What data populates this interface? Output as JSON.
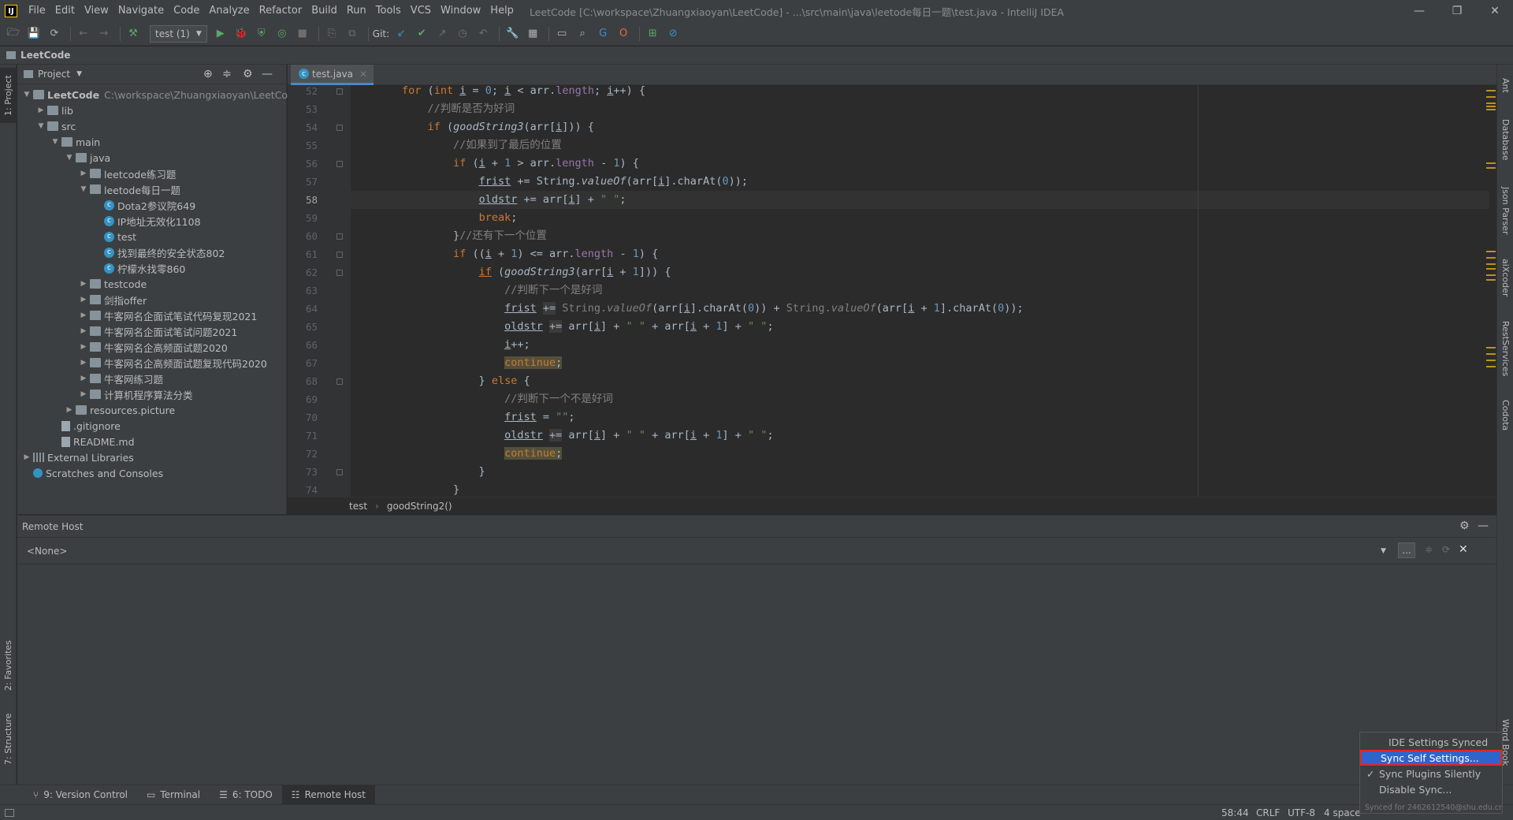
{
  "window": {
    "title": "LeetCode [C:\\workspace\\Zhuangxiaoyan\\LeetCode] - ...\\src\\main\\java\\leetode每日一题\\test.java - IntelliJ IDEA",
    "app_logo": "IJ",
    "controls": {
      "minimize": "—",
      "restore": "❐",
      "close": "✕"
    }
  },
  "menu": [
    "File",
    "Edit",
    "View",
    "Navigate",
    "Code",
    "Analyze",
    "Refactor",
    "Build",
    "Run",
    "Tools",
    "VCS",
    "Window",
    "Help"
  ],
  "toolbar": {
    "run_config": "test (1)",
    "git_label": "Git:"
  },
  "navbar": {
    "project_name": "LeetCode"
  },
  "left_strip": {
    "project_tab": "1: Project",
    "favorites_tab": "2: Favorites",
    "structure_tab": "7: Structure"
  },
  "right_strip": {
    "ant": "Ant",
    "database": "Database",
    "json_parser": "Json Parser",
    "aixcoder": "aiXcoder",
    "rest_services": "RestServices",
    "codota": "Codota",
    "word_book": "Word Book"
  },
  "project": {
    "header_label": "Project",
    "tree": [
      {
        "label": "LeetCode",
        "extra": "C:\\workspace\\Zhuangxiaoyan\\LeetCode",
        "depth": 0,
        "kind": "folder",
        "state": "open",
        "bold": true
      },
      {
        "label": "lib",
        "depth": 1,
        "kind": "folder",
        "state": "closed"
      },
      {
        "label": "src",
        "depth": 1,
        "kind": "folder",
        "state": "open"
      },
      {
        "label": "main",
        "depth": 2,
        "kind": "folder",
        "state": "open"
      },
      {
        "label": "java",
        "depth": 3,
        "kind": "folder",
        "state": "open"
      },
      {
        "label": "leetcode练习题",
        "depth": 4,
        "kind": "folder",
        "state": "closed"
      },
      {
        "label": "leetode每日一题",
        "depth": 4,
        "kind": "folder",
        "state": "open"
      },
      {
        "label": "Dota2参议院649",
        "depth": 5,
        "kind": "class",
        "state": "none"
      },
      {
        "label": "IP地址无效化1108",
        "depth": 5,
        "kind": "class",
        "state": "none"
      },
      {
        "label": "test",
        "depth": 5,
        "kind": "class",
        "state": "none"
      },
      {
        "label": "找到最终的安全状态802",
        "depth": 5,
        "kind": "class",
        "state": "none"
      },
      {
        "label": "柠檬水找零860",
        "depth": 5,
        "kind": "class",
        "state": "none"
      },
      {
        "label": "testcode",
        "depth": 4,
        "kind": "folder",
        "state": "closed"
      },
      {
        "label": "剑指offer",
        "depth": 4,
        "kind": "folder",
        "state": "closed"
      },
      {
        "label": "牛客网名企面试笔试代码复现2021",
        "depth": 4,
        "kind": "folder",
        "state": "closed"
      },
      {
        "label": "牛客网名企面试笔试问题2021",
        "depth": 4,
        "kind": "folder",
        "state": "closed"
      },
      {
        "label": "牛客网名企高频面试题2020",
        "depth": 4,
        "kind": "folder",
        "state": "closed"
      },
      {
        "label": "牛客网名企高频面试题复现代码2020",
        "depth": 4,
        "kind": "folder",
        "state": "closed"
      },
      {
        "label": "牛客网练习题",
        "depth": 4,
        "kind": "folder",
        "state": "closed"
      },
      {
        "label": "计算机程序算法分类",
        "depth": 4,
        "kind": "folder",
        "state": "closed"
      },
      {
        "label": "resources.picture",
        "depth": 3,
        "kind": "folder",
        "state": "closed"
      },
      {
        "label": ".gitignore",
        "depth": 2,
        "kind": "file",
        "state": "none"
      },
      {
        "label": "README.md",
        "depth": 2,
        "kind": "file",
        "state": "none"
      },
      {
        "label": "External Libraries",
        "depth": 0,
        "kind": "lib",
        "state": "closed"
      },
      {
        "label": "Scratches and Consoles",
        "depth": 0,
        "kind": "scratch",
        "state": "none"
      }
    ]
  },
  "editor": {
    "tab_label": "test.java",
    "current_line": 58,
    "lines": [
      {
        "n": 52,
        "html": "        <span class=\"kw\">for</span> (<span class=\"kw\">int</span> <span class=\"ul\">i</span> = <span class=\"num\">0</span>; <span class=\"ul\">i</span> &lt; arr.<span class=\"fld\">length</span>; <span class=\"ul\">i</span>++) {"
      },
      {
        "n": 53,
        "html": "            <span class=\"cmt\">//判断是否为好词</span>"
      },
      {
        "n": 54,
        "html": "            <span class=\"kw\">if</span> (<span class=\"it\">goodString3</span>(arr[<span class=\"ul\">i</span>])) {"
      },
      {
        "n": 55,
        "html": "                <span class=\"cmt\">//如果到了最后的位置</span>"
      },
      {
        "n": 56,
        "html": "                <span class=\"kw\">if</span> (<span class=\"ul\">i</span> + <span class=\"num\">1</span> &gt; arr.<span class=\"fld\">length</span> - <span class=\"num\">1</span>) {"
      },
      {
        "n": 57,
        "html": "                    <span class=\"ul\">frist</span> += String.<span class=\"it\">valueOf</span>(arr[<span class=\"ul\">i</span>].charAt(<span class=\"num\">0</span>));"
      },
      {
        "n": 58,
        "html": "                    <span class=\"ul\">oldstr</span> += arr[<span class=\"ul\">i</span>] + <span class=\"str\">\" \"</span>;"
      },
      {
        "n": 59,
        "html": "                    <span class=\"kw\">break</span>;"
      },
      {
        "n": 60,
        "html": "                }<span class=\"cmt\">//还有下一个位置</span>"
      },
      {
        "n": 61,
        "html": "                <span class=\"kw\">if</span> ((<span class=\"ul\">i</span> + <span class=\"num\">1</span>) &lt;= arr.<span class=\"fld\">length</span> - <span class=\"num\">1</span>) {"
      },
      {
        "n": 62,
        "html": "                    <span class=\"kw ul\">if</span> (<span class=\"it\">goodString3</span>(arr[<span class=\"ul\">i</span> + <span class=\"num\">1</span>])) {"
      },
      {
        "n": 63,
        "html": "                        <span class=\"cmt\">//判断下一个是好词</span>"
      },
      {
        "n": 64,
        "html": "                        <span class=\"ul\">frist</span> <span class=\"hl\">+=</span> <span class=\"cmt\">String.</span><span class=\"cmt it\">valueOf</span>(arr[<span class=\"ul\">i</span>].charAt(<span class=\"num\">0</span>)) + <span class=\"cmt\">String.</span><span class=\"cmt it\">valueOf</span>(arr[<span class=\"ul\">i</span> + <span class=\"num\">1</span>].charAt(<span class=\"num\">0</span>));"
      },
      {
        "n": 65,
        "html": "                        <span class=\"ul\">oldstr</span> <span class=\"hl\">+=</span> arr[<span class=\"ul\">i</span>] + <span class=\"str\">\" \"</span> + arr[<span class=\"ul\">i</span> + <span class=\"num\">1</span>] + <span class=\"str\">\" \"</span>;"
      },
      {
        "n": 66,
        "html": "                        <span class=\"ul\">i</span>++;"
      },
      {
        "n": 67,
        "html": "                        <span class=\"kw warn\">continue</span><span class=\"warn\">;</span>"
      },
      {
        "n": 68,
        "html": "                    } <span class=\"kw\">else</span> {"
      },
      {
        "n": 69,
        "html": "                        <span class=\"cmt\">//判断下一个不是好词</span>"
      },
      {
        "n": 70,
        "html": "                        <span class=\"ul\">frist</span> = <span class=\"str\">\"\"</span>;"
      },
      {
        "n": 71,
        "html": "                        <span class=\"ul\">oldstr</span> <span class=\"hl\">+=</span> arr[<span class=\"ul\">i</span>] + <span class=\"str\">\" \"</span> + arr[<span class=\"ul\">i</span> + <span class=\"num\">1</span>] + <span class=\"str\">\" \"</span>;"
      },
      {
        "n": 72,
        "html": "                        <span class=\"kw warn\">continue</span><span class=\"warn\">;</span>"
      },
      {
        "n": 73,
        "html": "                    }"
      },
      {
        "n": 74,
        "html": "                }"
      }
    ],
    "breadcrumb": [
      "test",
      "goodString2()"
    ]
  },
  "remote_host": {
    "title": "Remote Host",
    "selected": "<None>",
    "more_button": "..."
  },
  "bottom_tabs": [
    {
      "label": "9: Version Control",
      "icon": "branch-icon"
    },
    {
      "label": "Terminal",
      "icon": "terminal-icon"
    },
    {
      "label": "6: TODO",
      "icon": "todo-icon"
    },
    {
      "label": "Remote Host",
      "icon": "remote-host-icon",
      "active": true
    }
  ],
  "status": {
    "position": "58:44",
    "line_sep": "CRLF",
    "encoding": "UTF-8",
    "indent": "4 space"
  },
  "popup": {
    "items": [
      {
        "label": "IDE Settings Synced",
        "checked": false,
        "selected": false,
        "disabled": true
      },
      {
        "label": "Sync Self Settings...",
        "checked": false,
        "selected": true
      },
      {
        "label": "Sync Plugins Silently",
        "checked": true,
        "selected": false
      },
      {
        "label": "Disable Sync...",
        "checked": false,
        "selected": false
      }
    ],
    "footer": "Synced for 2462612540@shu.edu.cn"
  },
  "colors": {
    "accent": "#2f65ca",
    "highlight_border": "#e0262b",
    "bg": "#2b2b2b",
    "panel": "#3c3f41"
  }
}
